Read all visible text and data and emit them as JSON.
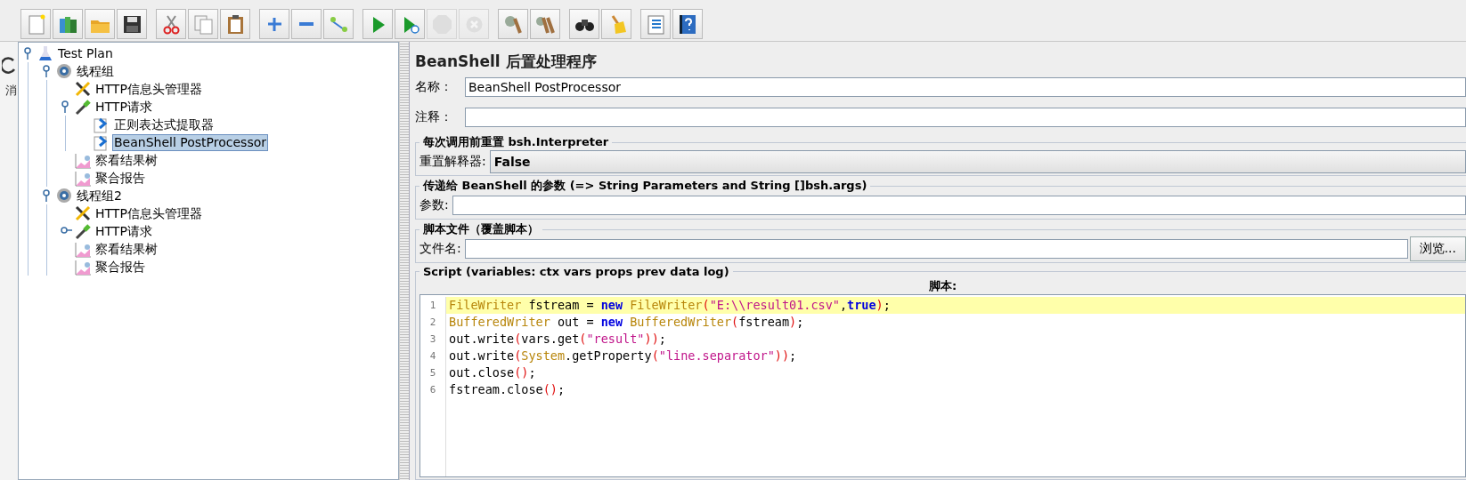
{
  "toolbar": {
    "groups": [
      [
        {
          "disabled": false
        },
        {
          "disabled": false
        },
        {
          "disabled": false
        },
        {
          "disabled": false
        }
      ],
      [
        {
          "disabled": false
        },
        {
          "disabled": false
        },
        {
          "disabled": false
        }
      ],
      [
        {
          "disabled": false
        },
        {
          "disabled": false
        },
        {
          "disabled": false
        }
      ],
      [
        {
          "disabled": false
        },
        {
          "disabled": false
        },
        {
          "disabled": true
        },
        {
          "disabled": true
        }
      ],
      [
        {
          "disabled": false
        },
        {
          "disabled": false
        }
      ],
      [
        {
          "disabled": false
        },
        {
          "disabled": false
        }
      ],
      [
        {
          "disabled": false
        },
        {
          "disabled": false
        }
      ]
    ]
  },
  "side_strip": {
    "label": "消"
  },
  "tree": {
    "items": [
      {
        "kind": "test-plan",
        "label": "Test Plan",
        "selected": false,
        "expanded": true,
        "children": [
          {
            "kind": "thread-group",
            "label": "线程组",
            "selected": false,
            "expanded": true,
            "children": [
              {
                "kind": "config",
                "label": "HTTP信息头管理器",
                "selected": false
              },
              {
                "kind": "sampler",
                "label": "HTTP请求",
                "selected": false,
                "expanded": true,
                "children": [
                  {
                    "kind": "post-processor",
                    "label": "正则表达式提取器",
                    "selected": false
                  },
                  {
                    "kind": "post-processor",
                    "label": "BeanShell PostProcessor",
                    "selected": true
                  }
                ]
              },
              {
                "kind": "listener",
                "label": "察看结果树",
                "selected": false
              },
              {
                "kind": "listener",
                "label": "聚合报告",
                "selected": false
              }
            ]
          },
          {
            "kind": "thread-group",
            "label": "线程组2",
            "selected": false,
            "expanded": true,
            "children": [
              {
                "kind": "config",
                "label": "HTTP信息头管理器",
                "selected": false
              },
              {
                "kind": "sampler",
                "label": "HTTP请求",
                "selected": false,
                "expanded": false
              },
              {
                "kind": "listener",
                "label": "察看结果树",
                "selected": false
              },
              {
                "kind": "listener",
                "label": "聚合报告",
                "selected": false
              }
            ]
          }
        ]
      }
    ]
  },
  "editor": {
    "title": "BeanShell 后置处理程序",
    "name_field": {
      "label": "名称：",
      "value": "BeanShell PostProcessor"
    },
    "comment_field": {
      "label": "注释："
    },
    "reset_group": {
      "title": "每次调用前重置 bsh.Interpreter",
      "label": "重置解释器:",
      "value": "False"
    },
    "params_group": {
      "title": "传递给 BeanShell 的参数 (=> String Parameters and String []bsh.args)",
      "label": "参数:"
    },
    "file_group": {
      "title": "脚本文件（覆盖脚本）",
      "label": "文件名:",
      "button": "浏览..."
    },
    "script_group": {
      "title": "Script (variables: ctx vars props prev data log)",
      "heading": "脚本:",
      "lines": [
        {
          "number": "1",
          "highlighted": true,
          "tokens": [
            {
              "kind": "type",
              "text": "FileWriter"
            },
            {
              "kind": "plain",
              "text": " fstream = "
            },
            {
              "kind": "keyword",
              "text": "new"
            },
            {
              "kind": "type",
              "text": " FileWriter"
            },
            {
              "kind": "paren",
              "text": "("
            },
            {
              "kind": "string",
              "text": "\"E:\\\\result01.csv\""
            },
            {
              "kind": "plain",
              "text": ","
            },
            {
              "kind": "keyword",
              "text": "true"
            },
            {
              "kind": "paren",
              "text": ")"
            },
            {
              "kind": "plain",
              "text": ";"
            }
          ]
        },
        {
          "number": "2",
          "highlighted": false,
          "tokens": [
            {
              "kind": "type",
              "text": "BufferedWriter"
            },
            {
              "kind": "plain",
              "text": " out = "
            },
            {
              "kind": "keyword",
              "text": "new"
            },
            {
              "kind": "type",
              "text": " BufferedWriter"
            },
            {
              "kind": "paren",
              "text": "("
            },
            {
              "kind": "plain",
              "text": "fstream"
            },
            {
              "kind": "paren",
              "text": ")"
            },
            {
              "kind": "plain",
              "text": ";"
            }
          ]
        },
        {
          "number": "3",
          "highlighted": false,
          "tokens": [
            {
              "kind": "plain",
              "text": "out.write"
            },
            {
              "kind": "paren",
              "text": "("
            },
            {
              "kind": "plain",
              "text": "vars.get"
            },
            {
              "kind": "paren",
              "text": "("
            },
            {
              "kind": "string",
              "text": "\"result\""
            },
            {
              "kind": "paren",
              "text": "))"
            },
            {
              "kind": "plain",
              "text": ";"
            }
          ]
        },
        {
          "number": "4",
          "highlighted": false,
          "tokens": [
            {
              "kind": "plain",
              "text": "out.write"
            },
            {
              "kind": "paren",
              "text": "("
            },
            {
              "kind": "type",
              "text": "System"
            },
            {
              "kind": "plain",
              "text": ".getProperty"
            },
            {
              "kind": "paren",
              "text": "("
            },
            {
              "kind": "string",
              "text": "\"line.separator\""
            },
            {
              "kind": "paren",
              "text": "))"
            },
            {
              "kind": "plain",
              "text": ";"
            }
          ]
        },
        {
          "number": "5",
          "highlighted": false,
          "tokens": [
            {
              "kind": "plain",
              "text": "out.close"
            },
            {
              "kind": "paren",
              "text": "()"
            },
            {
              "kind": "plain",
              "text": ";"
            }
          ]
        },
        {
          "number": "6",
          "highlighted": false,
          "tokens": [
            {
              "kind": "plain",
              "text": "fstream.close"
            },
            {
              "kind": "paren",
              "text": "()"
            },
            {
              "kind": "plain",
              "text": ";"
            }
          ]
        }
      ]
    }
  }
}
